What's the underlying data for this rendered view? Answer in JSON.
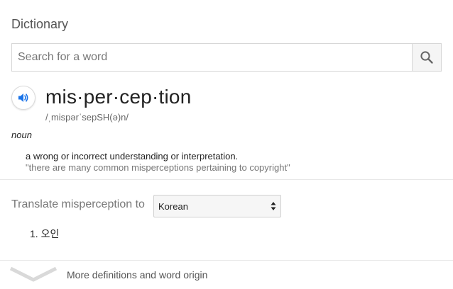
{
  "header": {
    "title": "Dictionary"
  },
  "search": {
    "placeholder": "Search for a word",
    "value": "",
    "icon": "search-icon"
  },
  "entry": {
    "audio_icon": "speaker-icon",
    "word": "mis·per·cep·tion",
    "phonetic": "/ˌmispərˈsepSH(ə)n/",
    "part_of_speech": "noun",
    "definitions": [
      {
        "text": "a wrong or incorrect understanding or interpretation.",
        "example": "\"there are many common misperceptions pertaining to copyright\""
      }
    ]
  },
  "translate": {
    "label": "Translate misperception to",
    "selected_language": "Korean",
    "results": [
      {
        "number": "1.",
        "text": "오인"
      }
    ]
  },
  "footer": {
    "more_label": "More definitions and word origin",
    "icon": "chevron-down-icon"
  },
  "colors": {
    "accent_blue": "#1a73e8",
    "text": "#222222",
    "muted": "#777777",
    "border": "#d6d6d6"
  }
}
